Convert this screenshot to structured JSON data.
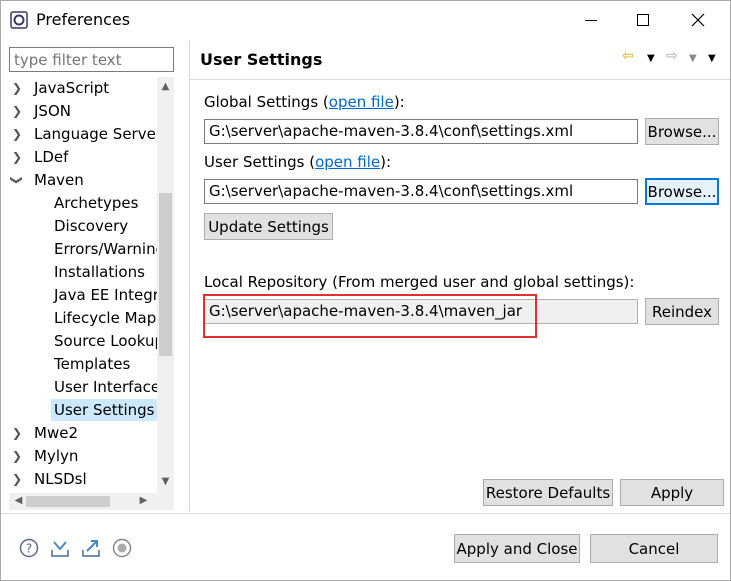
{
  "window": {
    "title": "Preferences"
  },
  "filter": {
    "placeholder": "type filter text"
  },
  "tree": {
    "items": [
      {
        "label": "JavaScript",
        "expander": ">"
      },
      {
        "label": "JSON",
        "expander": ">"
      },
      {
        "label": "Language Servers",
        "expander": ">"
      },
      {
        "label": "LDef",
        "expander": ">"
      },
      {
        "label": "Maven",
        "expander": "v"
      },
      {
        "label": "Archetypes"
      },
      {
        "label": "Discovery"
      },
      {
        "label": "Errors/Warnings"
      },
      {
        "label": "Installations"
      },
      {
        "label": "Java EE Integration"
      },
      {
        "label": "Lifecycle Mappings"
      },
      {
        "label": "Source Lookup"
      },
      {
        "label": "Templates"
      },
      {
        "label": "User Interface"
      },
      {
        "label": "User Settings",
        "selected": true
      },
      {
        "label": "Mwe2",
        "expander": ">"
      },
      {
        "label": "Mylyn",
        "expander": ">"
      },
      {
        "label": "NLSDsl",
        "expander": ">"
      }
    ]
  },
  "page": {
    "title": "User Settings",
    "global_label": "Global Settings",
    "global_link": "open file",
    "global_value": "G:\\server\\apache-maven-3.8.4\\conf\\settings.xml",
    "browse_label": "Browse...",
    "user_label": "User Settings",
    "user_link": "open file",
    "user_value": "G:\\server\\apache-maven-3.8.4\\conf\\settings.xml",
    "update_label": "Update Settings",
    "local_label": "Local Repository (From merged user and global settings):",
    "local_value": "G:\\server\\apache-maven-3.8.4\\maven_jar",
    "reindex_label": "Reindex",
    "restore_label": "Restore Defaults",
    "apply_label": "Apply"
  },
  "footer": {
    "apply_close_label": "Apply and Close",
    "cancel_label": "Cancel"
  },
  "colors": {
    "accent": "#0078d7",
    "link": "#0066cc",
    "highlight": "#e03030"
  }
}
